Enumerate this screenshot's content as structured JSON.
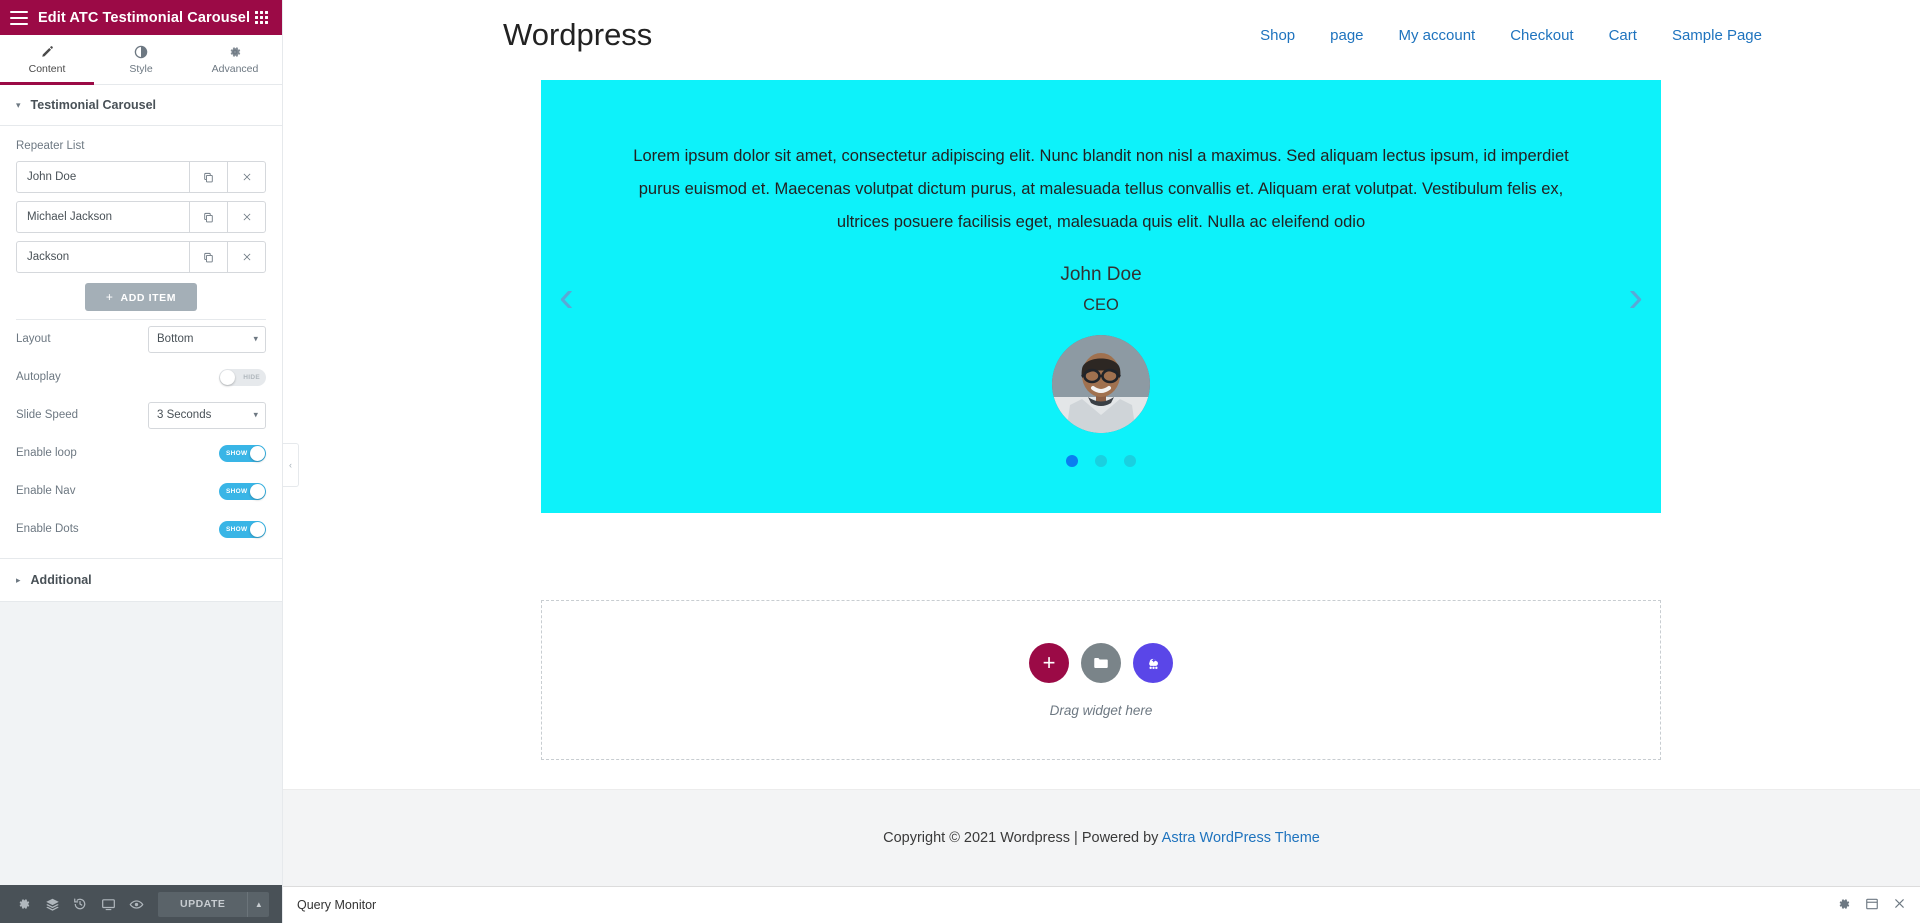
{
  "panel": {
    "header": {
      "title": "Edit ATC Testimonial Carousel",
      "menu_icon": "hamburger-icon",
      "apps_icon": "grid-apps-icon"
    },
    "tabs": [
      {
        "label": "Content",
        "icon": "pencil-icon",
        "active": true
      },
      {
        "label": "Style",
        "icon": "contrast-icon",
        "active": false
      },
      {
        "label": "Advanced",
        "icon": "gear-icon",
        "active": false
      }
    ],
    "section": {
      "title": "Testimonial Carousel",
      "caret": "▾"
    },
    "repeater": {
      "label": "Repeater List",
      "items": [
        {
          "name": "John Doe",
          "duplicate_icon": "copy-icon",
          "remove_icon": "close-icon"
        },
        {
          "name": "Michael Jackson",
          "duplicate_icon": "copy-icon",
          "remove_icon": "close-icon"
        },
        {
          "name": "Jackson",
          "duplicate_icon": "copy-icon",
          "remove_icon": "close-icon"
        }
      ],
      "add_label": "ADD ITEM",
      "add_plus": "+"
    },
    "settings": [
      {
        "label": "Layout",
        "type": "select",
        "value": "Bottom"
      },
      {
        "label": "Autoplay",
        "type": "toggle",
        "state": "off",
        "text": "HIDE"
      },
      {
        "label": "Slide Speed",
        "type": "select",
        "value": "3 Seconds"
      },
      {
        "label": "Enable loop",
        "type": "toggle",
        "state": "on",
        "text": "SHOW"
      },
      {
        "label": "Enable Nav",
        "type": "toggle",
        "state": "on",
        "text": "SHOW"
      },
      {
        "label": "Enable Dots",
        "type": "toggle",
        "state": "on",
        "text": "SHOW"
      }
    ],
    "additional": {
      "title": "Additional",
      "caret": "▸"
    },
    "footer": {
      "icons": [
        "gear-icon",
        "layers-icon",
        "history-icon",
        "responsive-icon",
        "preview-eye-icon"
      ],
      "update_label": "UPDATE",
      "update_arrow": "▲"
    },
    "collapse_handle": "‹"
  },
  "site": {
    "title": "Wordpress",
    "nav": [
      "Shop",
      "page",
      "My account",
      "Checkout",
      "Cart",
      "Sample Page"
    ]
  },
  "carousel": {
    "text": "Lorem ipsum dolor sit amet, consectetur adipiscing elit. Nunc blandit non nisl a maximus. Sed aliquam lectus ipsum, id imperdiet purus euismod et. Maecenas volutpat dictum purus, at malesuada tellus convallis et. Aliquam erat volutpat. Vestibulum felis ex, ultrices posuere facilisis eget, malesuada quis elit. Nulla ac eleifend odio",
    "name": "John Doe",
    "job_title": "CEO",
    "prev_arrow": "‹",
    "next_arrow": "›",
    "dots": [
      {
        "active": true
      },
      {
        "active": false
      },
      {
        "active": false
      }
    ],
    "background_color": "#0df2fa",
    "active_dot_color": "#0a7ef0",
    "dot_color": "#1ad0e0"
  },
  "dropzone": {
    "add_icon": "plus-icon",
    "folder_icon": "folder-icon",
    "ai_icon": "ai-cloud-icon",
    "label": "Drag widget here"
  },
  "footer": {
    "copyright": "Copyright © 2021 Wordpress | Powered by ",
    "link": "Astra WordPress Theme"
  },
  "status": {
    "text": "Query Monitor",
    "icons": [
      "settings-icon",
      "window-icon",
      "close-icon"
    ]
  }
}
